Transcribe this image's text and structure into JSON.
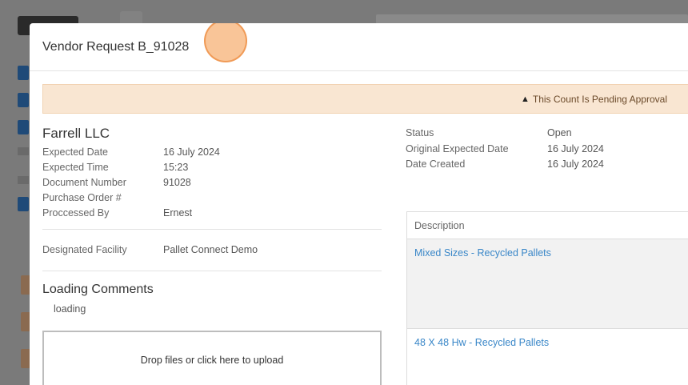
{
  "modal": {
    "title": "Vendor Request B_91028",
    "alert": "This Count Is Pending Approval",
    "alert_icon": "warning-icon"
  },
  "vendor": {
    "name": "Farrell LLC",
    "fields": [
      {
        "label": "Expected Date",
        "value": "16 July 2024"
      },
      {
        "label": "Expected Time",
        "value": "15:23"
      },
      {
        "label": "Document Number",
        "value": "91028"
      },
      {
        "label": "Purchase Order #",
        "value": ""
      },
      {
        "label": "Proccessed By",
        "value": "Ernest"
      }
    ],
    "facility_label": "Designated Facility",
    "facility_value": "Pallet Connect Demo"
  },
  "comments": {
    "heading": "Loading Comments",
    "text": "loading"
  },
  "upload": {
    "label": "Drop files or click here to upload"
  },
  "status": {
    "fields": [
      {
        "label": "Status",
        "value": "Open"
      },
      {
        "label": "Original Expected Date",
        "value": "16 July 2024"
      },
      {
        "label": "Date Created",
        "value": "16 July 2024"
      }
    ]
  },
  "items_table": {
    "header": "Description",
    "rows": [
      {
        "description": "Mixed Sizes - Recycled Pallets"
      },
      {
        "description": "48 X 48 Hw - Recycled Pallets"
      }
    ]
  }
}
